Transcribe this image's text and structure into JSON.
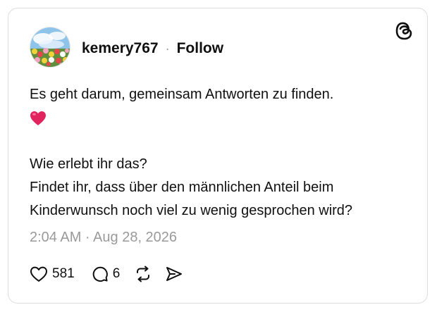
{
  "post": {
    "username": "kemery767",
    "separator": "·",
    "follow_label": "Follow",
    "text_line_1": "Es geht darum, gemeinsam Antworten zu finden.",
    "emoji": "❤️",
    "text_line_3": "Wie erlebt ihr das?",
    "text_line_4": "Findet ihr, dass über den männlichen Anteil beim",
    "text_line_5": "Kinderwunsch noch viel zu wenig gesprochen wird?",
    "timestamp": "2:04 AM · Aug 28, 2026"
  },
  "actions": {
    "like_count": "581",
    "reply_count": "6"
  },
  "icons": {
    "brand": "threads-logo-icon",
    "avatar": "avatar-image",
    "like": "heart-icon",
    "reply": "comment-bubble-icon",
    "repost": "repost-icon",
    "share": "share-send-icon"
  },
  "colors": {
    "text": "#101010",
    "muted": "#9a9a9a",
    "border": "#dcdcdc",
    "heart_emoji": "#e0245e"
  }
}
